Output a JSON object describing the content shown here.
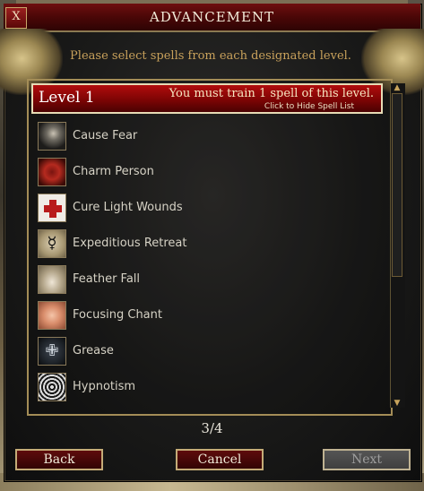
{
  "window": {
    "title": "ADVANCEMENT",
    "close_label": "X"
  },
  "instruction": "Please select spells from each designated level.",
  "level": {
    "title": "Level 1",
    "message": "You must train 1 spell of this level.",
    "hide_link": "Click to Hide Spell List"
  },
  "spells": [
    {
      "label": "Cause Fear",
      "icon": "cause-fear-icon"
    },
    {
      "label": "Charm Person",
      "icon": "charm-person-icon"
    },
    {
      "label": "Cure Light Wounds",
      "icon": "cure-light-wounds-icon"
    },
    {
      "label": "Expeditious Retreat",
      "icon": "expeditious-retreat-icon"
    },
    {
      "label": "Feather Fall",
      "icon": "feather-fall-icon"
    },
    {
      "label": "Focusing Chant",
      "icon": "focusing-chant-icon"
    },
    {
      "label": "Grease",
      "icon": "grease-icon"
    },
    {
      "label": "Hypnotism",
      "icon": "hypnotism-icon"
    }
  ],
  "page": "3/4",
  "buttons": {
    "back": "Back",
    "cancel": "Cancel",
    "next": "Next"
  },
  "colors": {
    "title_bar": "#6e0f0f",
    "level_header": "#b10d0d",
    "instruction_text": "#c8a15b",
    "button_border": "#c4ab77"
  }
}
